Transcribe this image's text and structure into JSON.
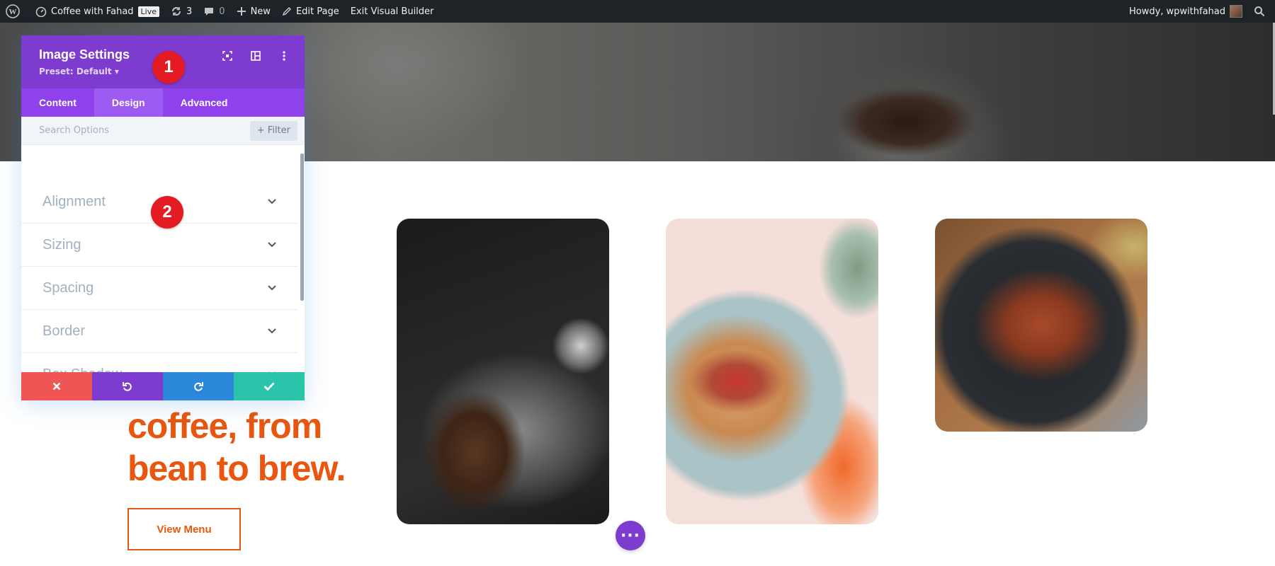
{
  "admin_bar": {
    "site_name": "Coffee with Fahad",
    "live_badge": "Live",
    "updates_count": "3",
    "comments_count": "0",
    "new_label": "New",
    "edit_page_label": "Edit Page",
    "exit_builder_label": "Exit Visual Builder",
    "howdy_label": "Howdy, wpwithfahad"
  },
  "modal": {
    "title": "Image Settings",
    "preset": "Preset: Default ▾",
    "tabs": [
      {
        "label": "Content",
        "active": false
      },
      {
        "label": "Design",
        "active": true
      },
      {
        "label": "Advanced",
        "active": false
      }
    ],
    "search_placeholder": "Search Options",
    "filter_label": "+ Filter",
    "options": [
      {
        "label": "Alignment"
      },
      {
        "label": "Sizing"
      },
      {
        "label": "Spacing"
      },
      {
        "label": "Border"
      },
      {
        "label": "Box Shadow"
      }
    ],
    "footer": {
      "discard_color": "#ef5555",
      "undo_color": "#7e3bd0",
      "redo_color": "#2b87da",
      "save_color": "#29c4a9"
    }
  },
  "markers": [
    "1",
    "2"
  ],
  "content": {
    "headline_line1": "coffee, from",
    "headline_line2": "bean to brew.",
    "cta_label": "View Menu",
    "accent_color": "#e8560f"
  },
  "fab_label": "···"
}
